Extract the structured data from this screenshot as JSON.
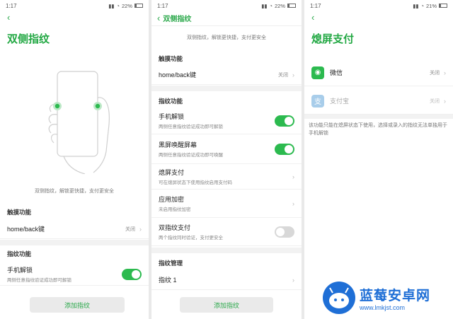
{
  "status": {
    "time": "1:17",
    "battery1": "22%",
    "battery2": "22%",
    "battery3": "21%"
  },
  "panel1": {
    "back_icon": "back-arrow-icon",
    "title": "双侧指纹",
    "caption": "双侧指纹，解锁更快捷，支付更安全",
    "touch_section": "触摸功能",
    "touch_row": {
      "label": "home/back键",
      "value": "关闭"
    },
    "fp_section": "指纹功能",
    "unlock_row": {
      "label": "手机解锁",
      "sub": "两侧任意指纹验证成功即可解锁"
    },
    "add_button": "添加指纹"
  },
  "panel2": {
    "title": "双侧指纹",
    "caption": "双侧指纹，解锁更快捷，支付更安全",
    "touch_section": "触摸功能",
    "touch_row": {
      "label": "home/back键",
      "value": "关闭"
    },
    "fp_section": "指纹功能",
    "rows": [
      {
        "label": "手机解锁",
        "sub": "两侧任意指纹验证成功即可解锁",
        "type": "toggle",
        "on": true
      },
      {
        "label": "黑屏唤醒屏幕",
        "sub": "两侧任意指纹验证成功即可唤醒",
        "type": "toggle",
        "on": true
      },
      {
        "label": "熄屏支付",
        "sub": "可在熄屏状态下使用指纹启用支付码",
        "type": "chevron"
      },
      {
        "label": "应用加密",
        "sub": "未启用指纹加密",
        "type": "chevron"
      },
      {
        "label": "双指纹支付",
        "sub": "两个指纹同时验证，支付更安全",
        "type": "toggle",
        "on": false
      }
    ],
    "manage_section": "指纹管理",
    "fp_item": "指纹 1",
    "add_button": "添加指纹"
  },
  "panel3": {
    "title": "熄屏支付",
    "wechat": {
      "label": "微信",
      "value": "关闭",
      "color": "#2cba4f"
    },
    "alipay": {
      "label": "支付宝",
      "value": "关闭",
      "color": "#a8cdea"
    },
    "note": "该功能只能在熄屏状态下使用，选择或录入的指纹无法单独用于手机解锁"
  },
  "watermark": {
    "title": "蓝莓安卓网",
    "url": "www.lmkjst.com",
    "color": "#1f6fd6"
  },
  "colors": {
    "accent": "#2aa84a",
    "toggle_on": "#2cba4f"
  }
}
